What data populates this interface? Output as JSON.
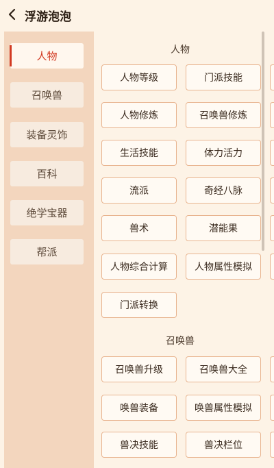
{
  "header": {
    "title": "浮游泡泡"
  },
  "sidebar": {
    "items": [
      {
        "label": "人物",
        "active": true
      },
      {
        "label": "召唤兽",
        "active": false
      },
      {
        "label": "装备灵饰",
        "active": false
      },
      {
        "label": "百科",
        "active": false
      },
      {
        "label": "绝学宝器",
        "active": false
      },
      {
        "label": "帮派",
        "active": false
      }
    ]
  },
  "sections": [
    {
      "title": "人物",
      "buttons": [
        "人物等级",
        "门派技能",
        "人物修炼",
        "召唤兽修炼",
        "生活技能",
        "体力活力",
        "流派",
        "奇经八脉",
        "兽术",
        "潜能果",
        "人物综合计算",
        "人物属性模拟",
        "门派转换"
      ]
    },
    {
      "title": "召唤兽",
      "buttons": [
        "召唤兽升级",
        "召唤兽大全",
        "唤兽装备",
        "唤兽属性模拟",
        "兽决技能",
        "兽决栏位"
      ]
    }
  ],
  "colors": {
    "accent": "#d23a22",
    "sidebar_bg": "#f3d6be",
    "page_bg": "#fdf3e6",
    "button_border": "#e8b48f"
  }
}
